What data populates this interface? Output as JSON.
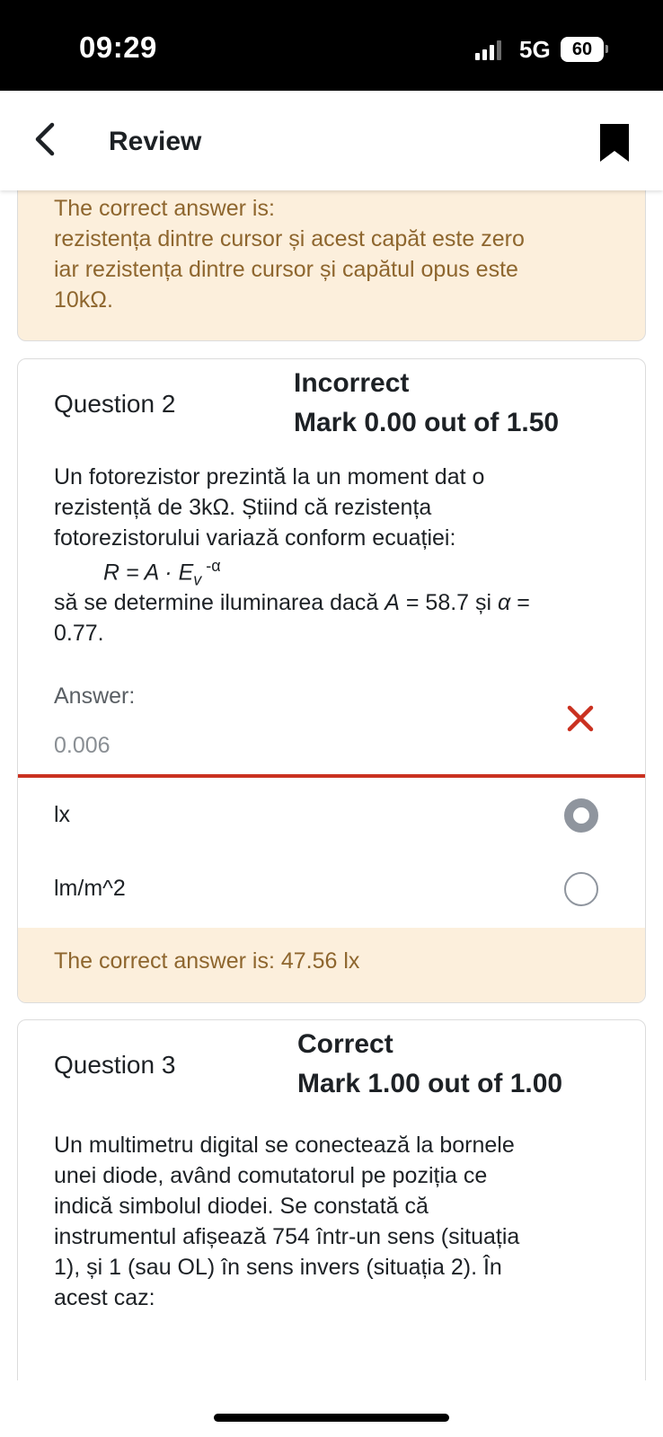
{
  "status_bar": {
    "time": "09:29",
    "network": "5G",
    "battery": "60"
  },
  "header": {
    "back_icon": "chevron-left-icon",
    "title": "Review",
    "bookmark_icon": "bookmark-icon"
  },
  "previous_feedback": {
    "line1": "The correct answer is:",
    "line2": "rezistența dintre cursor și acest capăt este zero",
    "line3": "iar rezistența dintre cursor și capătul opus este",
    "line4": "10kΩ."
  },
  "question2": {
    "label": "Question 2",
    "state": "Incorrect",
    "mark": "Mark 0.00 out of 1.50",
    "text_line1": "Un fotorezistor prezintă la un moment dat o",
    "text_line2": "rezistență de 3kΩ. Știind că rezistența",
    "text_line3": "fotorezistorului variază conform ecuației:",
    "formula_main": "R = A · E",
    "formula_sub": "v",
    "formula_sup": " -α",
    "text_after1_pre": "să se determine iluminarea dacă ",
    "text_after1_a": "A",
    "text_after1_mid": " = 58.7 și ",
    "text_after1_alpha": "α",
    "text_after1_end": " =",
    "text_after2": "0.77.",
    "answer_label": "Answer:",
    "answer_value": "0.006",
    "answer_status_icon": "close-icon",
    "units": [
      {
        "label": "lx",
        "selected": true
      },
      {
        "label": "lm/m^2",
        "selected": false
      }
    ],
    "feedback": "The correct answer is: 47.56 lx"
  },
  "question3": {
    "label": "Question 3",
    "state": "Correct",
    "mark": "Mark 1.00 out of 1.00",
    "text_line1": "Un multimetru digital se conectează la bornele",
    "text_line2": "unei diode, având comutatorul pe poziția ce",
    "text_line3": "indică simbolul diodei. Se constată că",
    "text_line4": "instrumentul afișează 754 într-un sens (situația",
    "text_line5": "1), și 1 (sau OL) în sens invers (situația 2). În",
    "text_line6": "acest caz:"
  },
  "colors": {
    "feedback_bg": "#fcefdc",
    "feedback_text": "#8e662e",
    "incorrect_red": "#ca3120"
  }
}
